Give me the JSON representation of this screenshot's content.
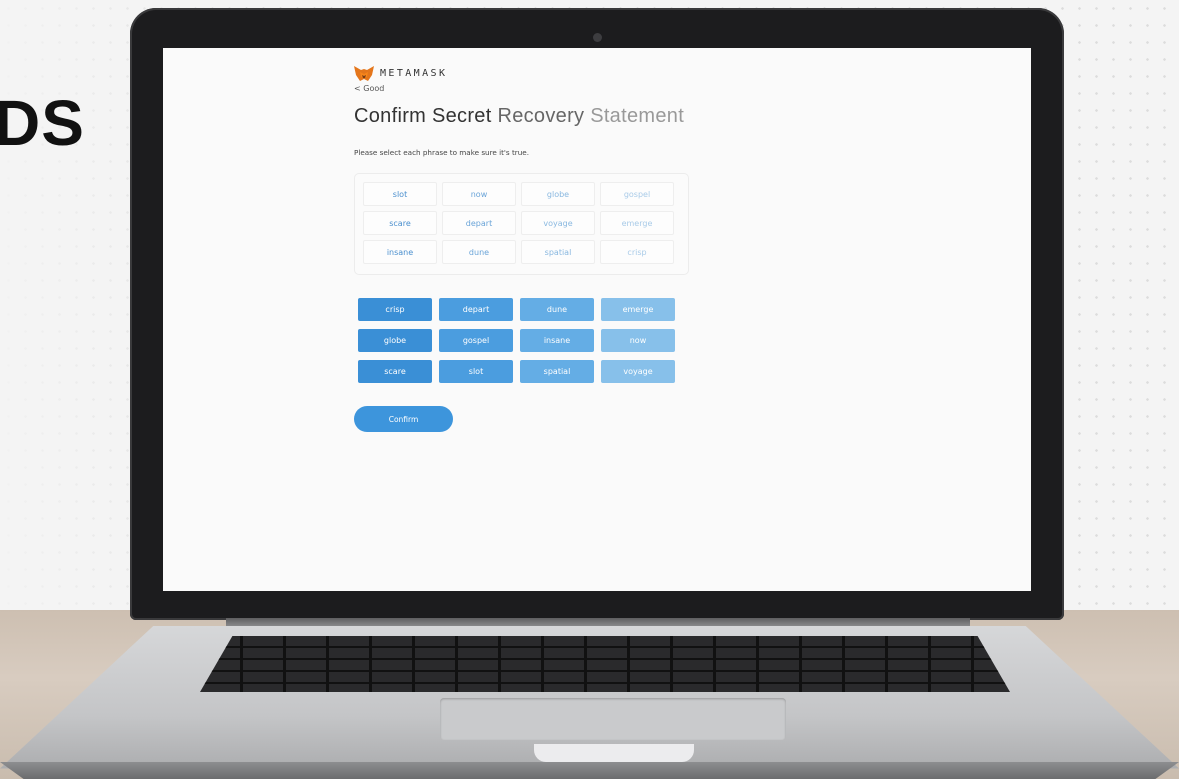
{
  "headline_fragment": "DS",
  "app": {
    "brand": "METAMASK",
    "back_label": "< Good",
    "title_parts": [
      "Confirm",
      "Secret",
      "Recovery",
      "Statement"
    ],
    "instruction": "Please select each phrase to make sure it's true.",
    "selected_words": [
      "slot",
      "now",
      "globe",
      "gospel",
      "scare",
      "depart",
      "voyage",
      "emerge",
      "insane",
      "dune",
      "spatial",
      "crisp"
    ],
    "choices": [
      "crisp",
      "depart",
      "dune",
      "emerge",
      "globe",
      "gospel",
      "insane",
      "now",
      "scare",
      "slot",
      "spatial",
      "voyage"
    ],
    "confirm_label": "Confirm"
  },
  "colors": {
    "accent": "#3d95dc",
    "chip_col1": "#3a8fd6",
    "chip_col2": "#4b9ddf",
    "chip_col3": "#64ade5",
    "chip_col4": "#87c0ea",
    "word_col1": "#4a8fce",
    "word_col2": "#6aa4d8",
    "word_col3": "#89b8e0",
    "word_col4": "#a9cbe8"
  },
  "icons": {
    "brand_logo": "fox-icon"
  }
}
